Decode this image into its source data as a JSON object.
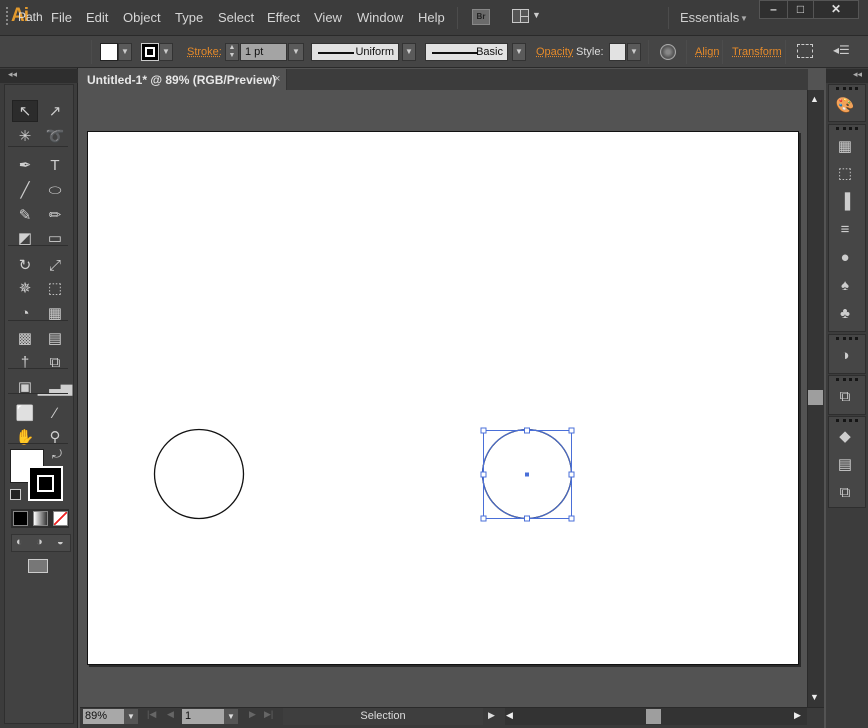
{
  "app": {
    "logo": "Ai"
  },
  "menubar": {
    "items": [
      "File",
      "Edit",
      "Object",
      "Type",
      "Select",
      "Effect",
      "View",
      "Window",
      "Help"
    ],
    "bridge_label": "Br",
    "workspace": "Essentials",
    "window_controls": {
      "minimize": "–",
      "maximize": "□",
      "close": "✕"
    }
  },
  "control_bar": {
    "selection_type": "Path",
    "fill_color": "#ffffff",
    "stroke_label": "Stroke:",
    "stroke_weight": "1 pt",
    "variable_width_profile": "Uniform",
    "brush_definition": "Basic",
    "opacity_label": "Opacity",
    "style_label": "Style:",
    "align_label": "Align",
    "transform_label": "Transform"
  },
  "document_tab": {
    "title": "Untitled-1* @ 89% (RGB/Preview)",
    "close": "×"
  },
  "tools": [
    {
      "name": "selection-tool",
      "glyph": "↖",
      "selected": true
    },
    {
      "name": "direct-selection-tool",
      "glyph": "↗"
    },
    {
      "name": "magic-wand-tool",
      "glyph": "✳"
    },
    {
      "name": "lasso-tool",
      "glyph": "➰"
    },
    {
      "name": "pen-tool",
      "glyph": "✒"
    },
    {
      "name": "type-tool",
      "glyph": "T"
    },
    {
      "name": "line-segment-tool",
      "glyph": "╱"
    },
    {
      "name": "ellipse-tool",
      "glyph": "⬭"
    },
    {
      "name": "paintbrush-tool",
      "glyph": "✎"
    },
    {
      "name": "pencil-tool",
      "glyph": "✏"
    },
    {
      "name": "blob-brush-tool",
      "glyph": "◩"
    },
    {
      "name": "eraser-tool",
      "glyph": "▭"
    },
    {
      "name": "rotate-tool",
      "glyph": "↻"
    },
    {
      "name": "scale-tool",
      "glyph": "⤢"
    },
    {
      "name": "warp-tool",
      "glyph": "✵"
    },
    {
      "name": "free-transform-tool",
      "glyph": "⬚"
    },
    {
      "name": "shape-builder-tool",
      "glyph": "◔"
    },
    {
      "name": "perspective-grid-tool",
      "glyph": "▦"
    },
    {
      "name": "mesh-tool",
      "glyph": "▩"
    },
    {
      "name": "gradient-tool",
      "glyph": "▤"
    },
    {
      "name": "eyedropper-tool",
      "glyph": "†"
    },
    {
      "name": "blend-tool",
      "glyph": "⧉"
    },
    {
      "name": "symbol-sprayer-tool",
      "glyph": "▣"
    },
    {
      "name": "column-graph-tool",
      "glyph": "▁▃▅"
    },
    {
      "name": "artboard-tool",
      "glyph": "⬜"
    },
    {
      "name": "slice-tool",
      "glyph": "∕"
    },
    {
      "name": "hand-tool",
      "glyph": "✋"
    },
    {
      "name": "zoom-tool",
      "glyph": "⚲"
    }
  ],
  "color_swatches": {
    "fill": "#ffffff",
    "stroke": "#000000"
  },
  "status_bar": {
    "zoom": "89%",
    "artboard_number": "1",
    "current_tool": "Selection"
  },
  "right_panels": [
    {
      "name": "color-panel-icon",
      "glyph": "🎨"
    },
    {
      "name": "swatches-panel-icon",
      "glyph": "▦"
    },
    {
      "name": "transform-panel-icon",
      "glyph": "⬚"
    },
    {
      "name": "align-panel-icon",
      "glyph": "▐"
    },
    {
      "name": "stroke-panel-icon",
      "glyph": "≡"
    },
    {
      "name": "appearance-panel-icon",
      "glyph": "●"
    },
    {
      "name": "brushes-panel-icon",
      "glyph": "♠"
    },
    {
      "name": "symbols-panel-icon",
      "glyph": "♣"
    },
    {
      "name": "transparency-panel-icon",
      "glyph": "◑"
    },
    {
      "name": "artboards-panel-icon",
      "glyph": "⧉"
    },
    {
      "name": "layers-panel-icon",
      "glyph": "◆"
    },
    {
      "name": "gradient-panel-icon",
      "glyph": "▤"
    },
    {
      "name": "pathfinder-panel-icon",
      "glyph": "⧉"
    }
  ],
  "canvas": {
    "objects": [
      {
        "type": "ellipse",
        "selected": false
      },
      {
        "type": "ellipse",
        "selected": true
      }
    ],
    "selection_color": "#4a6fd8"
  }
}
